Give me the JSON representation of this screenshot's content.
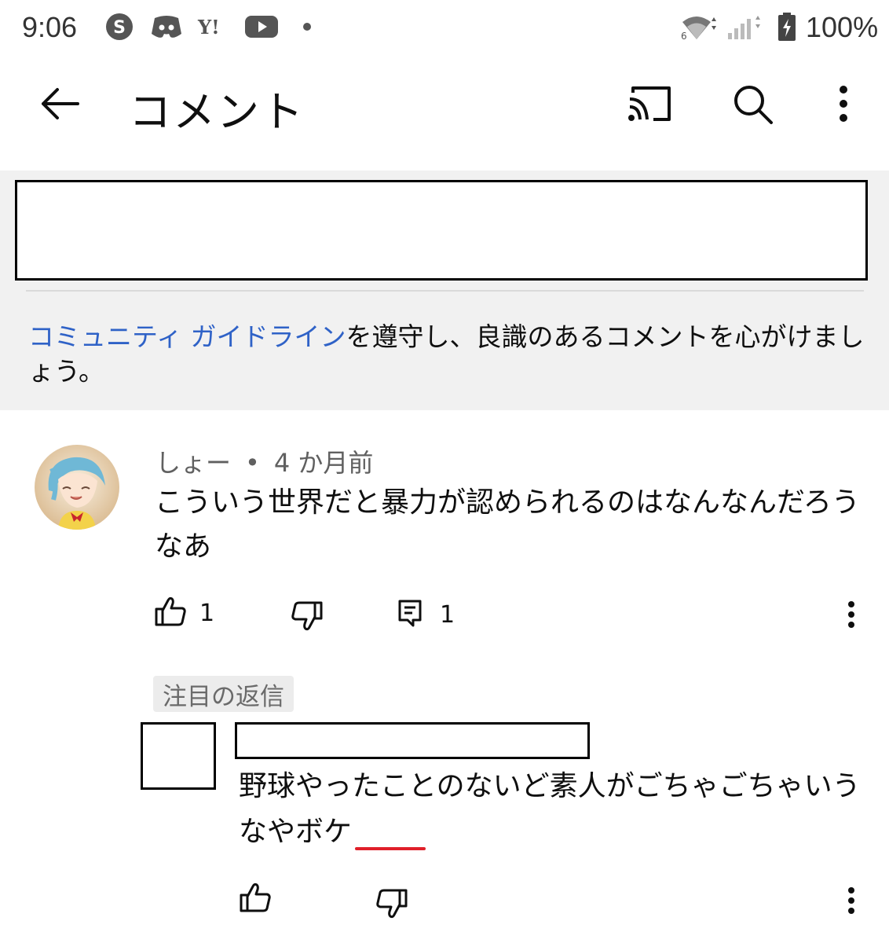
{
  "status_bar": {
    "time": "9:06",
    "battery": "100%",
    "icons": [
      "skype-icon",
      "discord-icon",
      "yahoo-icon",
      "youtube-icon",
      "wifi-icon",
      "signal-icon",
      "battery-icon"
    ]
  },
  "app_bar": {
    "title": "コメント",
    "icons": [
      "back-arrow-icon",
      "cast-icon",
      "search-icon",
      "more-vert-icon"
    ]
  },
  "guidelines": {
    "link": "コミュニティ ガイドライン",
    "text": "を遵守し、良識のあるコメントを心がけましょう。"
  },
  "comment": {
    "author": "しょー",
    "separator": "•",
    "time": "4 か月前",
    "text": "こういう世界だと暴力が認められるのはなんなんだろうなあ",
    "likes": "1",
    "replies": "1"
  },
  "highlight_chip": "注目の返信",
  "reply": {
    "text_main": "野球やったことのないど素人がごちゃごちゃいうなや",
    "text_marked": "ボケ"
  },
  "colors": {
    "link": "#2f62c7",
    "panel_bg": "#f1f1f1",
    "underline": "#e0202a"
  }
}
